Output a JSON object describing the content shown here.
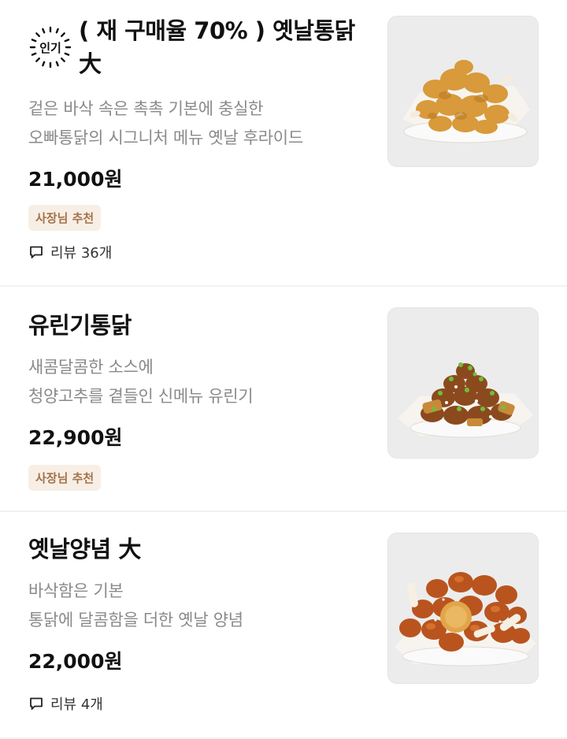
{
  "items": [
    {
      "badge": "인기",
      "name": "( 재 구매율 70% ) 옛날통닭 大",
      "desc_line1": "겉은 바삭 속은 촉촉 기본에 충실한",
      "desc_line2": "오빠통닭의 시그니처 메뉴 옛날 후라이드",
      "price": "21,000원",
      "tag": "사장님 추천",
      "review": "리뷰 36개",
      "image_icon": "fried-chicken-image"
    },
    {
      "name": "유린기통닭",
      "desc_line1": "새콤달콤한 소스에",
      "desc_line2": "청양고추를 곁들인 신메뉴 유린기",
      "price": "22,900원",
      "tag": "사장님 추천",
      "image_icon": "yuringi-chicken-image"
    },
    {
      "name": "옛날양념 大",
      "desc_line1": "바삭함은 기본",
      "desc_line2": "통닭에 달콤함을 더한 옛날 양념",
      "price": "22,000원",
      "review": "리뷰 4개",
      "image_icon": "seasoned-chicken-image"
    }
  ],
  "colors": {
    "tag_bg": "#f7efe6",
    "tag_text": "#a5724a",
    "desc_text": "#8a8a8a"
  }
}
